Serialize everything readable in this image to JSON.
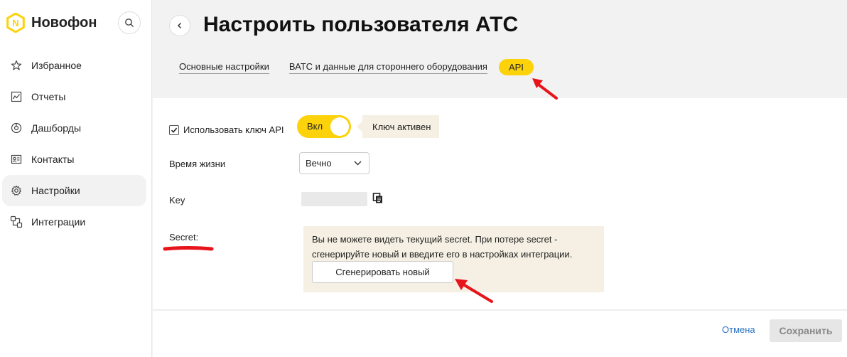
{
  "brand": {
    "name": "Новофон",
    "logo_letter": "N"
  },
  "sidebar": {
    "items": [
      {
        "label": "Избранное",
        "icon": "star-icon"
      },
      {
        "label": "Отчеты",
        "icon": "reports-icon"
      },
      {
        "label": "Дашборды",
        "icon": "dashboard-icon"
      },
      {
        "label": "Контакты",
        "icon": "contacts-icon"
      },
      {
        "label": "Настройки",
        "icon": "gear-icon",
        "active": true
      },
      {
        "label": "Интеграции",
        "icon": "integrations-icon"
      }
    ]
  },
  "page": {
    "title": "Настроить пользователя АТС"
  },
  "tabs": [
    {
      "label": "Основные настройки"
    },
    {
      "label": "ВАТС и данные для стороннего оборудования"
    },
    {
      "label": "API",
      "active": true
    }
  ],
  "form": {
    "use_api_key": {
      "label": "Использовать ключ API",
      "checked": true
    },
    "toggle": {
      "label": "Вкл",
      "on": true
    },
    "key_status": "Ключ активен",
    "lifetime": {
      "label": "Время жизни",
      "value": "Вечно"
    },
    "key": {
      "label": "Key"
    },
    "secret": {
      "label": "Secret:",
      "notice_line1": "Вы не можете видеть текущий secret. При потере secret -",
      "notice_line2": "сгенерируйте новый и введите его в настройках интеграции.",
      "generate_label": "Сгенерировать новый"
    }
  },
  "footer": {
    "cancel_label": "Отмена",
    "save_label": "Сохранить"
  },
  "colors": {
    "accent": "#fcd20a",
    "link": "#2a73c4",
    "annotation": "#e8141b"
  }
}
